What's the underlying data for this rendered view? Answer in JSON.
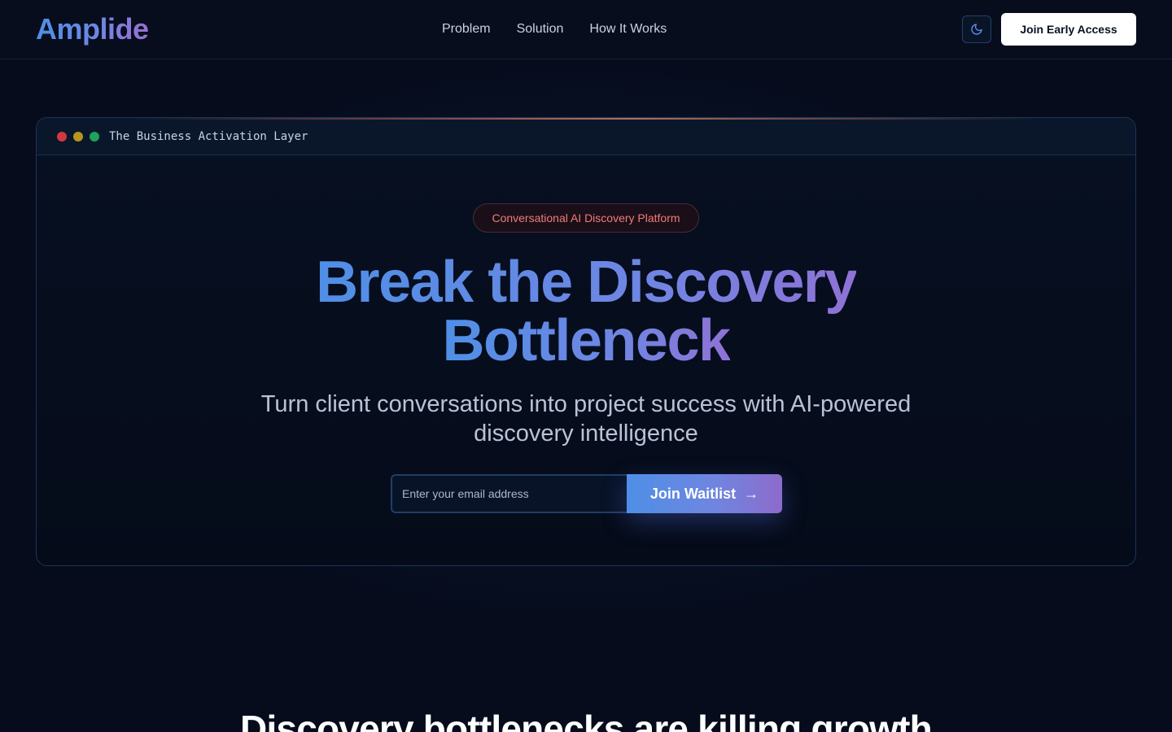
{
  "header": {
    "logo": "Amplide",
    "nav": [
      "Problem",
      "Solution",
      "How It Works"
    ],
    "theme_icon": "moon-icon",
    "cta_label": "Join Early Access"
  },
  "hero_card": {
    "window_title": "The Business Activation Layer",
    "badge": "Conversational AI Discovery Platform",
    "headline_line1": "Break the Discovery",
    "headline_line2": "Bottleneck",
    "subheadline": "Turn client conversations into project success with AI-powered discovery intelligence",
    "email_placeholder": "Enter your email address",
    "submit_label": "Join Waitlist",
    "submit_arrow": "→"
  },
  "next_section": {
    "title": "Discovery bottlenecks are killing growth"
  },
  "colors": {
    "background": "#060c1c",
    "accent_blue": "#4f8fe6",
    "accent_purple": "#8d6bcc",
    "badge_text": "#f27a7a"
  }
}
